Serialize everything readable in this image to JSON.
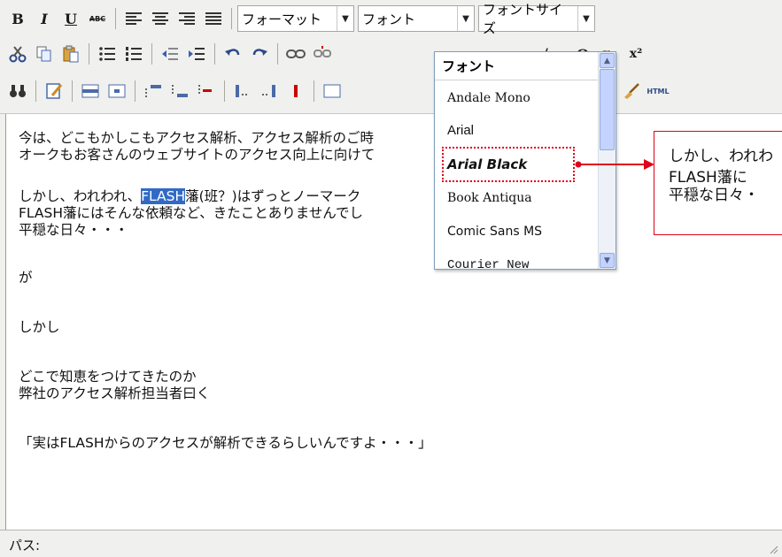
{
  "toolbar": {
    "row1": {
      "bold_label": "B",
      "italic_label": "I",
      "underline_label": "U",
      "strike_label": "ABC",
      "format_select": "フォーマット",
      "font_select": "フォント",
      "size_select": "フォントサイズ"
    },
    "row2": {
      "omega_label": "Ω",
      "subscript_label": "x₂",
      "superscript_label": "x²",
      "html_label": "HTML"
    }
  },
  "content": {
    "line1": "今は、どこもかしこもアクセス解析、アクセス解析のご時",
    "line2": "オークもお客さんのウェブサイトのアクセス向上に向けて",
    "line3_before": "しかし、われわれ、",
    "line3_selected": "FLASH",
    "line3_after": "藩(班？)はずっとノーマーク",
    "line4": "FLASH藩にはそんな依頼など、きたことありませんでし",
    "line5": "平穏な日々・・・",
    "line6": "が",
    "line7": "しかし",
    "line8": "どこで知恵をつけてきたのか",
    "line9": "弊社のアクセス解析担当者曰く",
    "line10": "「実はFLASHからのアクセスが解析できるらしいんですよ・・・」"
  },
  "status": {
    "path_label": "パス:"
  },
  "font_dropdown": {
    "title": "フォント",
    "items": [
      "Andale Mono",
      "Arial",
      "Arial Black",
      "Book Antiqua",
      "Comic Sans MS",
      "Courier New"
    ],
    "focused": "Arial Black"
  },
  "callout": {
    "line1": "しかし、われわ",
    "line2": "FLASH藩に",
    "line3": "平穏な日々・"
  },
  "colors": {
    "highlight": "#316ac5",
    "annotation": "#e0001a"
  }
}
